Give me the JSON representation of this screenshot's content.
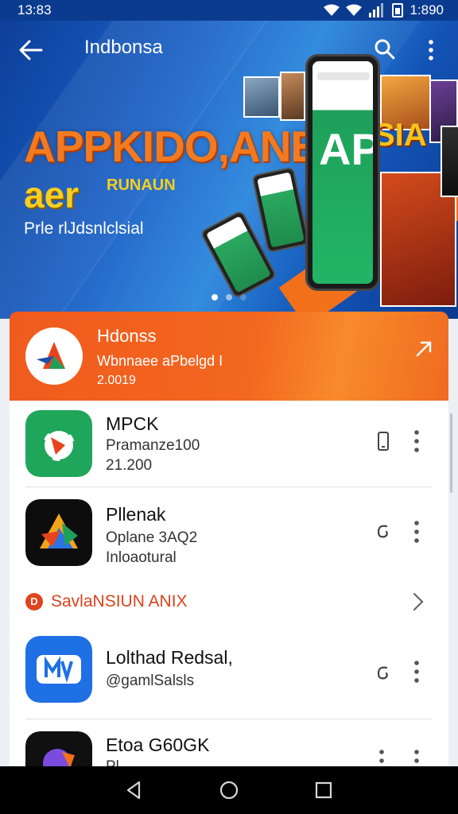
{
  "status_bar": {
    "time": "13:83",
    "battery_label": "1:890"
  },
  "app_bar": {
    "title": "Indbonsa"
  },
  "hero": {
    "headline": "APPKIDO,ANE",
    "headline_tail": "SIA",
    "sub_big": "aer",
    "sub_small": "RUNAUN",
    "tagline": "Prle rlJdsnlclsial",
    "phone_text": "AP",
    "dots_total": 3,
    "dots_active": 1
  },
  "featured": {
    "title": "Hdonss",
    "subtitle": "Wbnnaee aPbelgd  I",
    "meta": "2.0019",
    "accent": "#f05a1e"
  },
  "apps": [
    {
      "name": "MPCK",
      "line1": "Pramanze100",
      "line2": "21.200",
      "action_icon": "phone-icon"
    },
    {
      "name": "Pllenak",
      "line1": "Oplane 3AQ2",
      "line2": "Inloaotural",
      "action_icon": "swirl-icon"
    }
  ],
  "section": {
    "icon_letter": "D",
    "title": "SavlaNSIUN ANIX",
    "color": "#d9431c"
  },
  "apps_more": [
    {
      "name": "Lolthad Redsal,",
      "line1": "@gamlSalsls",
      "action_icon": "swirl-icon"
    },
    {
      "name": "Etoa G60GK",
      "line1": "Pl...",
      "action_icon": "dots-icon"
    }
  ],
  "colors": {
    "status_bar": "#0b3b8f",
    "brand_orange": "#f05a1e",
    "green": "#1fa65a"
  }
}
